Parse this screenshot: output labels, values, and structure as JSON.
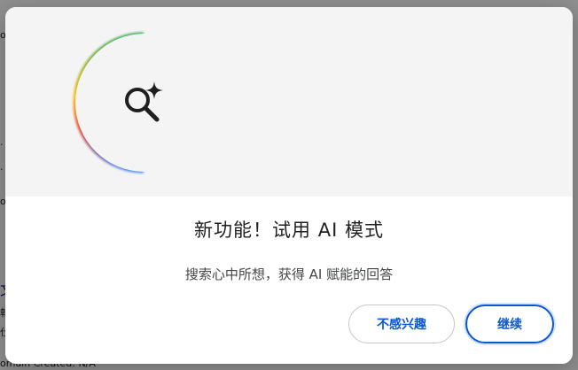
{
  "background_page": {
    "fragments": [
      "or",
      "·",
      "·",
      "or",
      "文",
      "報",
      "仕",
      "omain Created: N/A"
    ]
  },
  "dialog": {
    "title": "新功能！试用 AI 模式",
    "subtitle": "搜索心中所想，获得 AI 赋能的回答",
    "hero_icon": "ai-search-sparkle-icon",
    "buttons": {
      "dismiss_label": "不感兴趣",
      "continue_label": "继续"
    }
  },
  "colors": {
    "accent": "#0b57d0",
    "glow_green": "#34a853",
    "glow_yellow": "#fbbc04",
    "glow_red": "#ea4335",
    "glow_blue": "#4285f4"
  }
}
